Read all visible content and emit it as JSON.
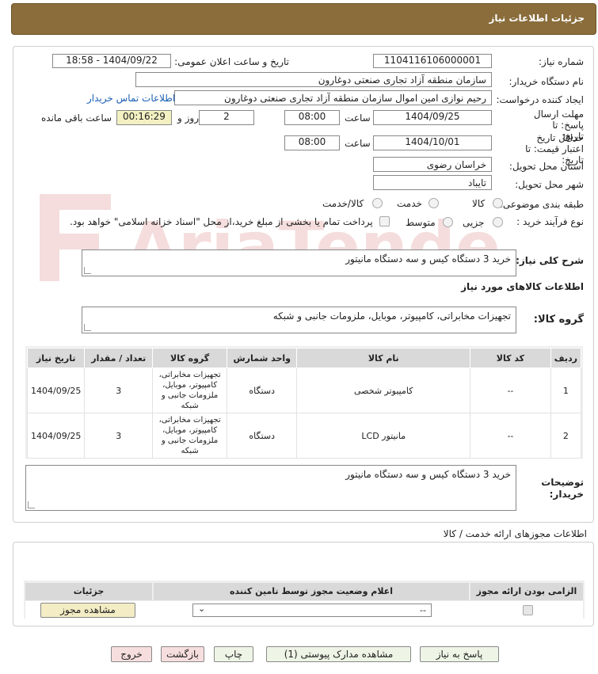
{
  "header": {
    "title": "جزئیات اطلاعات نیاز"
  },
  "watermark": {
    "text": "AriaTender.neT"
  },
  "form": {
    "need_number_label": "شماره نیاز:",
    "need_number": "1104116106000001",
    "announce_label": "تاریخ و ساعت اعلان عمومی:",
    "announce_value": "1404/09/22 - 18:58",
    "buyer_org_label": "نام دستگاه خریدار:",
    "buyer_org": "سازمان منطقه آزاد تجاری صنعتی دوغارون",
    "creator_label": "ایجاد کننده درخواست:",
    "creator": "رحیم نوازی امین اموال سازمان منطقه آزاد تجاری صنعتی دوغارون",
    "contact_link": "اطلاعات تماس خریدار",
    "deadline_label": "مهلت ارسال پاسخ: تا تاریخ:",
    "deadline_date": "1404/09/25",
    "time_label": "ساعت",
    "deadline_time": "08:00",
    "days": "2",
    "days_label": "روز و",
    "remaining_timer": "00:16:29",
    "remaining_label": "ساعت باقی مانده",
    "validity_label": "حداقل تاریخ اعتبار قیمت: تا تاریخ:",
    "validity_date": "1404/10/01",
    "validity_time": "08:00",
    "province_label": "استان محل تحویل:",
    "province": "خراسان رضوی",
    "city_label": "شهر محل تحویل:",
    "city": "تایباد",
    "category_label": "طبقه بندی موضوعی:",
    "category_options": [
      "کالا",
      "خدمت",
      "کالا/خدمت"
    ],
    "process_label": "نوع فرآیند خرید :",
    "process_options": [
      "جزیی",
      "متوسط"
    ],
    "payment_note": "پرداخت تمام یا بخشی از مبلغ خرید،از محل \"اسناد خزانه اسلامی\" خواهد بود.",
    "summary_label": "شرح کلی نیاز:",
    "summary": "خرید 3 دستگاه کیس و سه دستگاه مانیتور",
    "goods_info_label": "اطلاعات کالاهای مورد نیاز",
    "goods_group_label": "گروه کالا:",
    "goods_group": "تجهیزات مخابراتی، کامپیوتر، موبایل، ملزومات جانبی و شبکه",
    "buyer_notes_label": "توضیحات خریدار:",
    "buyer_notes": "خرید 3 دستگاه کیس و سه دستگاه مانیتور"
  },
  "items_table": {
    "headers": [
      "ردیف",
      "کد کالا",
      "نام کالا",
      "واحد شمارش",
      "گروه کالا",
      "تعداد / مقدار",
      "تاریخ نیاز"
    ],
    "rows": [
      [
        "1",
        "--",
        "کامپیوتر شخصی",
        "دستگاه",
        "تجهیزات مخابراتی، کامپیوتر، موبایل، ملزومات جانبی و شبکه",
        "3",
        "1404/09/25"
      ],
      [
        "2",
        "--",
        "مانیتور LCD",
        "دستگاه",
        "تجهیزات مخابراتی، کامپیوتر، موبایل، ملزومات جانبی و شبکه",
        "3",
        "1404/09/25"
      ]
    ]
  },
  "permits": {
    "title": "اطلاعات مجوزهای ارائه خدمت / کالا",
    "headers": [
      "الزامی بودن ارائه مجوز",
      "اعلام وضعیت مجوز توسط تامین کننده",
      "جزئیات"
    ],
    "select_value": "--",
    "view_button": "مشاهده مجوز"
  },
  "buttons": {
    "reply": "پاسخ به نیاز",
    "attachments": "مشاهده مدارک پیوستی (1)",
    "print": "چاپ",
    "back": "بازگشت",
    "exit": "خروج"
  }
}
